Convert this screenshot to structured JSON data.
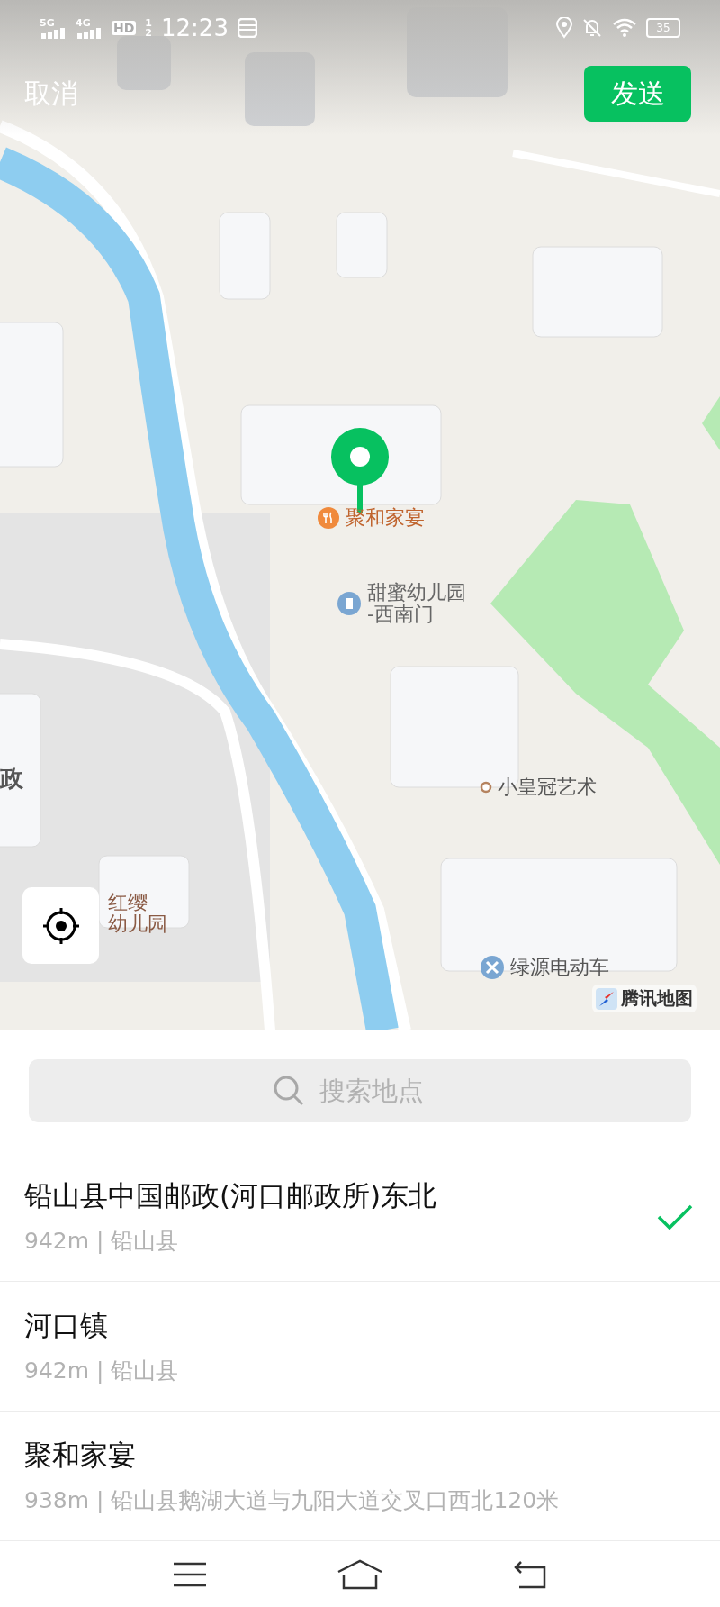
{
  "status_bar": {
    "signals": [
      {
        "label": "5G"
      },
      {
        "label": "4G"
      }
    ],
    "hd": "HD",
    "hd_slots": [
      "1",
      "2"
    ],
    "time": "12:23",
    "battery": "35"
  },
  "header": {
    "cancel": "取消",
    "send": "发送"
  },
  "map": {
    "labels": [
      {
        "kind": "restaurant",
        "lines": [
          "聚和家宴"
        ]
      },
      {
        "kind": "school",
        "lines": [
          "甜蜜幼儿园",
          "-西南门"
        ]
      },
      {
        "kind": "district",
        "lines": [
          "政"
        ]
      },
      {
        "kind": "spot",
        "lines": [
          "小皇冠艺术"
        ]
      },
      {
        "kind": "kindergarten",
        "lines": [
          "红缨",
          "幼儿园"
        ]
      },
      {
        "kind": "repair",
        "lines": [
          "绿源电动车"
        ]
      }
    ],
    "attribution": "腾讯地图"
  },
  "search": {
    "placeholder": "搜索地点"
  },
  "places": [
    {
      "name": "铅山县中国邮政(河口邮政所)东北",
      "detail": "942m | 铅山县",
      "selected": true
    },
    {
      "name": "河口镇",
      "detail": "942m | 铅山县",
      "selected": false
    },
    {
      "name": "聚和家宴",
      "detail": "938m | 铅山县鹅湖大道与九阳大道交叉口西北120米",
      "selected": false
    }
  ]
}
